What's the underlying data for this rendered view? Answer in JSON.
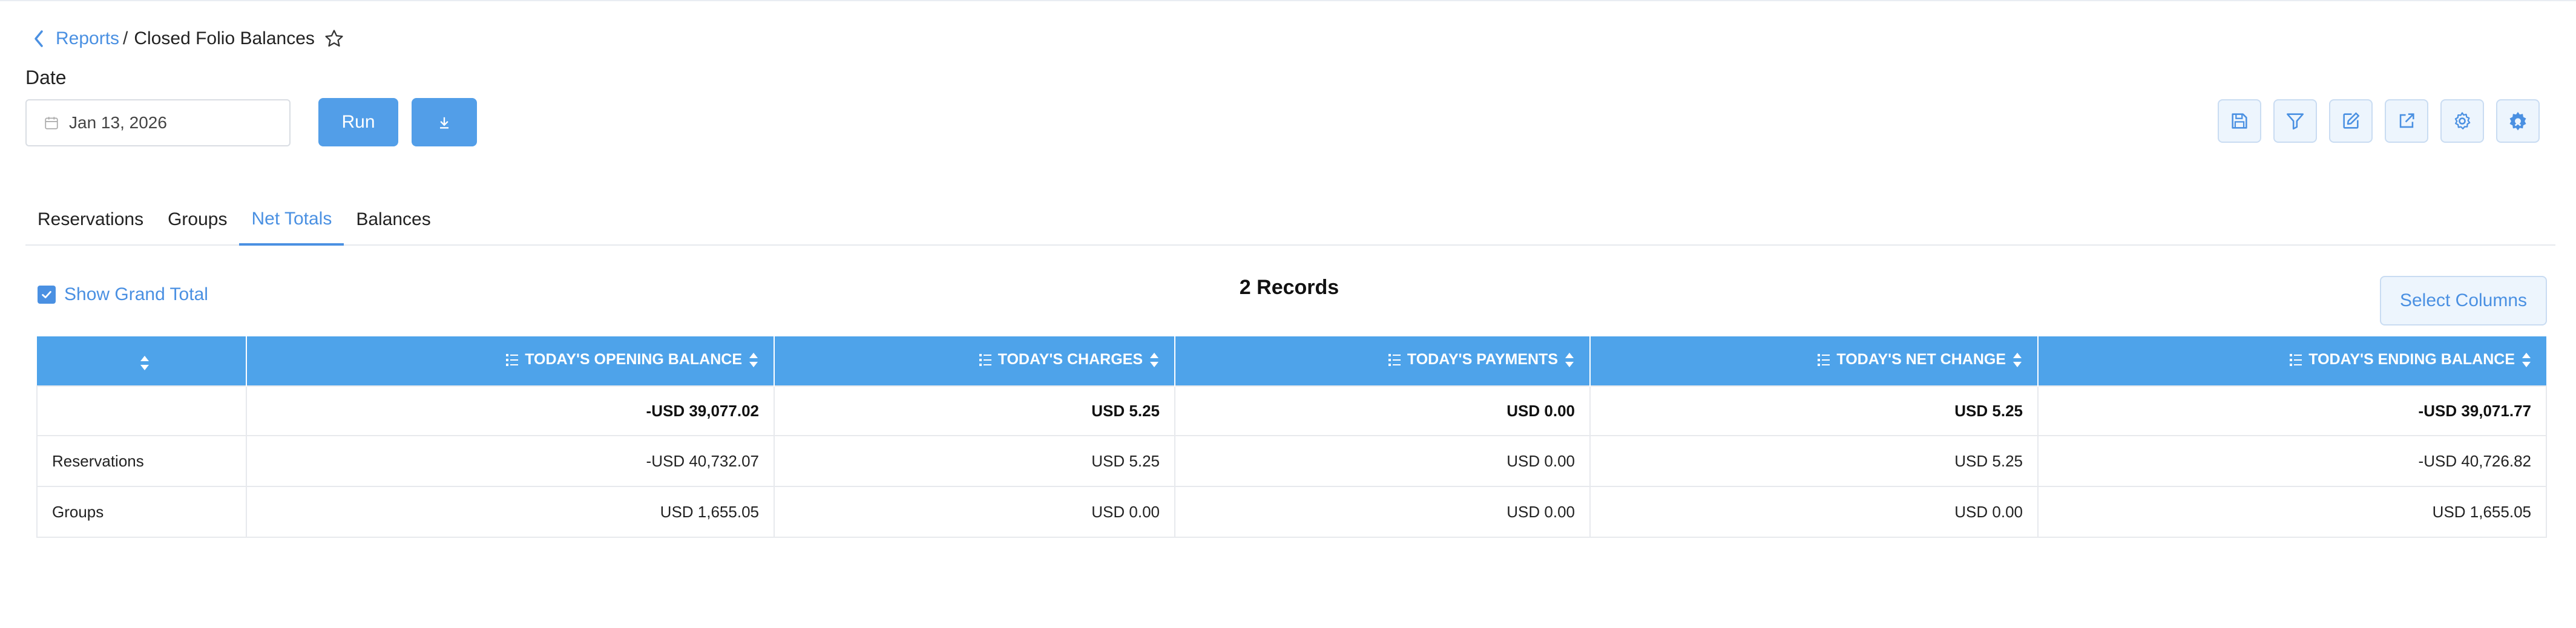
{
  "breadcrumb": {
    "parent": "Reports",
    "separator": "/",
    "current": "Closed Folio Balances"
  },
  "date": {
    "label": "Date",
    "value": "Jan 13, 2026"
  },
  "actions": {
    "run_label": "Run"
  },
  "toolbar": {
    "icons": [
      "save-icon",
      "filter-icon",
      "edit-icon",
      "export-icon",
      "settings-icon",
      "advanced-settings-icon"
    ]
  },
  "tabs": [
    {
      "label": "Reservations",
      "active": false
    },
    {
      "label": "Groups",
      "active": false
    },
    {
      "label": "Net Totals",
      "active": true
    },
    {
      "label": "Balances",
      "active": false
    }
  ],
  "controls": {
    "show_grand_total_label": "Show Grand Total",
    "show_grand_total_checked": true,
    "records_count": "2 Records",
    "select_columns_label": "Select Columns"
  },
  "table": {
    "columns": [
      "",
      "Today's Opening Balance",
      "Today's Charges",
      "Today's Payments",
      "Today's Net Change",
      "Today's Ending Balance"
    ],
    "grand_total": [
      "",
      "-USD 39,077.02",
      "USD 5.25",
      "USD 0.00",
      "USD 5.25",
      "-USD 39,071.77"
    ],
    "rows": [
      [
        "Reservations",
        "-USD 40,732.07",
        "USD 5.25",
        "USD 0.00",
        "USD 5.25",
        "-USD 40,726.82"
      ],
      [
        "Groups",
        "USD 1,655.05",
        "USD 0.00",
        "USD 0.00",
        "USD 0.00",
        "USD 1,655.05"
      ]
    ]
  },
  "colors": {
    "accent": "#4a90e2",
    "header_bg": "#4ea3ea",
    "button_bg": "#529ee8"
  }
}
